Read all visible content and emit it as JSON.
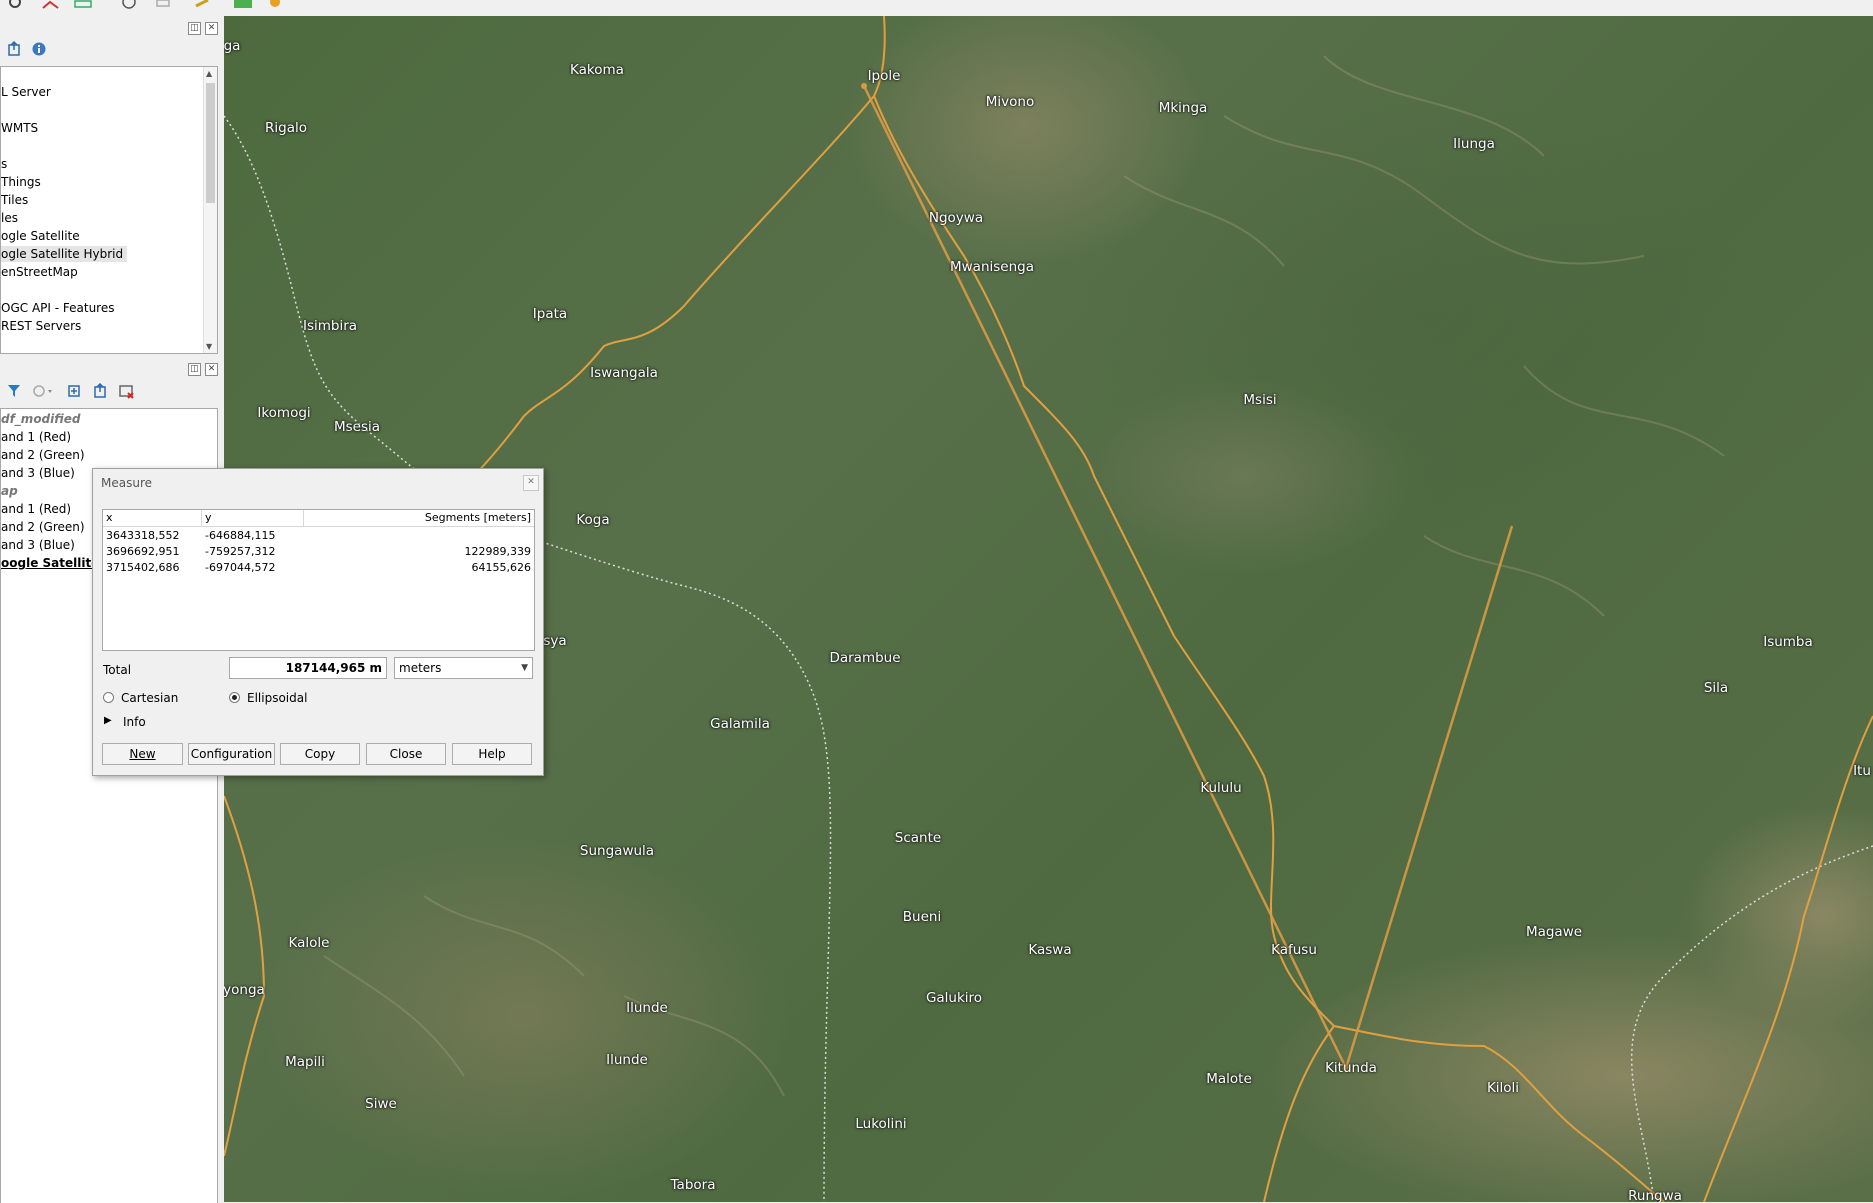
{
  "colors": {
    "map_road": "#e0a040",
    "measure_line": "#d99a45",
    "dialog_bg": "#f0f0f0"
  },
  "browser_panel": {
    "items": [
      "L Server",
      "WMTS",
      "s",
      "Things",
      " Tiles",
      "les",
      "ogle Satellite",
      "ogle Satellite Hybrid",
      "enStreetMap",
      "OGC API - Features",
      " REST Servers"
    ]
  },
  "layers_panel": {
    "items": [
      {
        "label": "df_modified",
        "kind": "group"
      },
      {
        "label": "and 1 (Red)",
        "kind": "band"
      },
      {
        "label": "and 2 (Green)",
        "kind": "band"
      },
      {
        "label": "and 3 (Blue)",
        "kind": "band"
      },
      {
        "label": "ap",
        "kind": "group"
      },
      {
        "label": "and 1 (Red)",
        "kind": "band"
      },
      {
        "label": "and 2 (Green)",
        "kind": "band"
      },
      {
        "label": "and 3 (Blue)",
        "kind": "band"
      },
      {
        "label": "oogle Satellite Hy",
        "kind": "selected"
      }
    ]
  },
  "measure": {
    "title": "Measure",
    "columns": [
      "x",
      "y",
      "Segments [meters]"
    ],
    "rows": [
      {
        "x": "3643318,552",
        "y": "-646884,115",
        "segment": ""
      },
      {
        "x": "3696692,951",
        "y": "-759257,312",
        "segment": "122989,339"
      },
      {
        "x": "3715402,686",
        "y": "-697044,572",
        "segment": "64155,626"
      }
    ],
    "total_label": "Total",
    "total_value": "187144,965 m",
    "unit": "meters",
    "cartesian_label": "Cartesian",
    "ellipsoidal_label": "Ellipsoidal",
    "info_label": "Info",
    "buttons": {
      "new": "New",
      "configuration": "Configuration",
      "copy": "Copy",
      "close": "Close",
      "help": "Help"
    }
  },
  "map": {
    "places": [
      "ga",
      "Kakoma",
      "Ipole",
      "Mivono",
      "Mkinga",
      "Rigalo",
      "Ilunga",
      "Ngoywa",
      "Mwanisenga",
      "Isimbira",
      "Ipata",
      "Iswangala",
      "Msisi",
      "Ikomogi",
      "Msesia",
      "Koga",
      "sya",
      "Darambue",
      "Isumba",
      "Sila",
      "Galamila",
      "Itu",
      "Kululu",
      "Scante",
      "Sungawula",
      "Bueni",
      "Magawe",
      "Kalole",
      "Kaswa",
      "Kafusu",
      "yonga",
      "Galukiro",
      "Ilunde",
      "Ilunde",
      "Mapili",
      "Kitunda",
      "Malote",
      "Kiloli",
      "Siwe",
      "Lukolini",
      "Tabora",
      "Rungwa"
    ]
  }
}
